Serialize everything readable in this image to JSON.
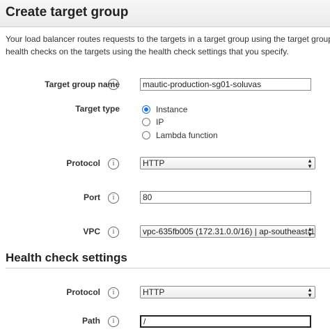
{
  "header": {
    "title": "Create target group"
  },
  "intro": {
    "line1": "Your load balancer routes requests to the targets in a target group using the target group s",
    "line2": "health checks on the targets using the health check settings that you specify."
  },
  "form": {
    "target_group_name": {
      "label": "Target group name",
      "value": "mautic-production-sg01-soluvas"
    },
    "target_type": {
      "label": "Target type",
      "options": [
        "Instance",
        "IP",
        "Lambda function"
      ],
      "selected": "Instance"
    },
    "protocol": {
      "label": "Protocol",
      "value": "HTTP"
    },
    "port": {
      "label": "Port",
      "value": "80"
    },
    "vpc": {
      "label": "VPC",
      "value": "vpc-635fb005 (172.31.0.0/16) | ap-southeast-1"
    }
  },
  "health": {
    "title": "Health check settings",
    "protocol": {
      "label": "Protocol",
      "value": "HTTP"
    },
    "path": {
      "label": "Path",
      "value": "/"
    }
  },
  "icons": {
    "info": "i"
  }
}
